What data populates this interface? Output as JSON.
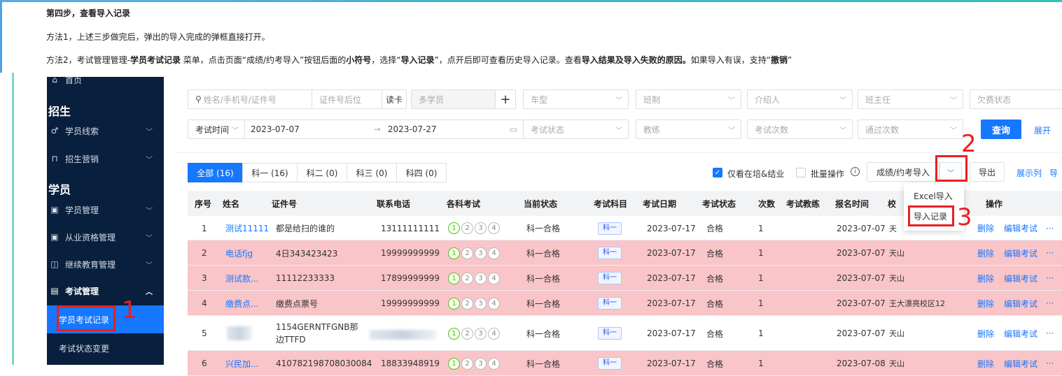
{
  "instructions": {
    "step_title": "第四步，查看导入记录",
    "method1": "方法1，上述三步做完后，弹出的导入完成的弹框直接打开。",
    "method2": {
      "p1": "方法2，考试管理管理-",
      "b1": "学员考试记录",
      "p2": " 菜单，点击页面“成绩/约考导入”按钮后面的",
      "b2": "小符号",
      "p3": "，选择“",
      "b3": "导入记录",
      "p4": "”，点开后即可查看历史导入记录。查看",
      "b4": "导入结果及导入失败的原因。",
      "p5": "如果导入有误，支持“",
      "b5": "撤销",
      "p6": "”"
    }
  },
  "sidebar": {
    "home": {
      "label": "首页",
      "icon": "home-icon"
    },
    "section_enroll": "招生",
    "item_leads": {
      "label": "学员线索",
      "icon": "leads-icon"
    },
    "item_marketing": {
      "label": "招生营销",
      "icon": "marketing-icon"
    },
    "section_students": "学员",
    "item_student_mgmt": {
      "label": "学员管理",
      "icon": "student-icon"
    },
    "item_qualification": {
      "label": "从业资格管理",
      "icon": "qualification-icon"
    },
    "item_education": {
      "label": "继续教育管理",
      "icon": "education-icon"
    },
    "item_exam": {
      "label": "考试管理",
      "icon": "exam-icon"
    },
    "sub_exam_record": "学员考试记录",
    "sub_exam_status": "考试状态变更"
  },
  "filters": {
    "name_placeholder": "姓名/手机号/证件号",
    "id_suffix_placeholder": "证件号后位",
    "read_card": "读卡",
    "multi_student": "多学员",
    "car_type": "车型",
    "class_type": "班制",
    "referrer": "介绍人",
    "head_teacher": "班主任",
    "arrears": "欠费状态",
    "exam_time_label": "考试时间",
    "date_start": "2023-07-07",
    "date_end": "2023-07-27",
    "exam_status": "考试状态",
    "coach": "教练",
    "exam_count": "考试次数",
    "pass_count": "通过次数",
    "query_button": "查询",
    "expand_link": "展开"
  },
  "tabs": [
    {
      "label": "全部 (16)",
      "active": true
    },
    {
      "label": "科一 (16)",
      "active": false
    },
    {
      "label": "科二 (0)",
      "active": false
    },
    {
      "label": "科三 (0)",
      "active": false
    },
    {
      "label": "科四 (0)",
      "active": false
    }
  ],
  "toolbar": {
    "only_active_label": "仅看在培&结业",
    "only_active_checked": true,
    "batch_label": "批量操作",
    "batch_checked": false,
    "import_button": "成绩/约考导入",
    "export_button": "导出",
    "show_columns": "展示列",
    "guide_char": "导"
  },
  "dropdown_menu": {
    "excel_import": "Excel导入",
    "import_record": "导入记录"
  },
  "annotations": [
    "1",
    "2",
    "3"
  ],
  "table": {
    "headers": [
      "序号",
      "姓名",
      "证件号",
      "联系电话",
      "各科考试",
      "当前状态",
      "考试科目",
      "考试日期",
      "考试状态",
      "次数",
      "考试教练",
      "报名时间",
      "校",
      "操作"
    ],
    "rows": [
      {
        "seq": "1",
        "name": "测试11111",
        "id": "都是给扫的谁的",
        "phone": "13111111111",
        "status": "科一合格",
        "subject": "科一",
        "date": "2023-07-17",
        "exam_status": "合格",
        "count": "1",
        "signup": "2023-07-07",
        "school": "天",
        "del": "删除",
        "edit": "编辑考试",
        "more": "···",
        "pink": false
      },
      {
        "seq": "2",
        "name": "电话fjg",
        "id": "4日343423423",
        "phone": "19999999999",
        "status": "科一合格",
        "subject": "科一",
        "date": "2023-07-17",
        "exam_status": "合格",
        "count": "1",
        "signup": "2023-07-07",
        "school": "天山",
        "del": "删除",
        "edit": "编辑考试",
        "more": "···",
        "pink": true
      },
      {
        "seq": "3",
        "name": "测试款...",
        "id": "11112233333",
        "phone": "17899999999",
        "status": "科一合格",
        "subject": "科一",
        "date": "2023-07-17",
        "exam_status": "合格",
        "count": "1",
        "signup": "2023-07-07",
        "school": "天山",
        "del": "删除",
        "edit": "编辑考试",
        "more": "···",
        "pink": true
      },
      {
        "seq": "4",
        "name": "缴费点...",
        "id": "缴费点票号",
        "phone": "19999999999",
        "status": "科一合格",
        "subject": "科一",
        "date": "2023-07-17",
        "exam_status": "合格",
        "count": "1",
        "signup": "2023-07-07",
        "school": "王大漂亮校区12",
        "del": "删除",
        "edit": "编辑考试",
        "more": "···",
        "pink": true
      },
      {
        "seq": "5",
        "name": "",
        "id": "1154GERNTFGNB那边TTFD",
        "phone": "",
        "status": "科一合格",
        "subject": "科一",
        "date": "2023-07-17",
        "exam_status": "合格",
        "count": "1",
        "signup": "2023-07-07",
        "school": "天山",
        "del": "删除",
        "edit": "编辑考试",
        "more": "···",
        "pink": false
      },
      {
        "seq": "6",
        "name": "兴民加...",
        "id": "410782198708030084",
        "phone": "18833948919",
        "status": "科一合格",
        "subject": "科一",
        "date": "2023-07-17",
        "exam_status": "合格",
        "count": "1",
        "signup": "2023-07-08",
        "school": "天山",
        "del": "删除",
        "edit": "编辑考试",
        "more": "···",
        "pink": true
      }
    ],
    "exam_circles": [
      "1",
      "2",
      "3",
      "4"
    ]
  },
  "colors": {
    "primary": "#1677ff",
    "sidebar_bg": "#081f3d",
    "row_pink": "#f9c5c9",
    "annotation_red": "#e82020",
    "pass_green": "#52c41a"
  }
}
